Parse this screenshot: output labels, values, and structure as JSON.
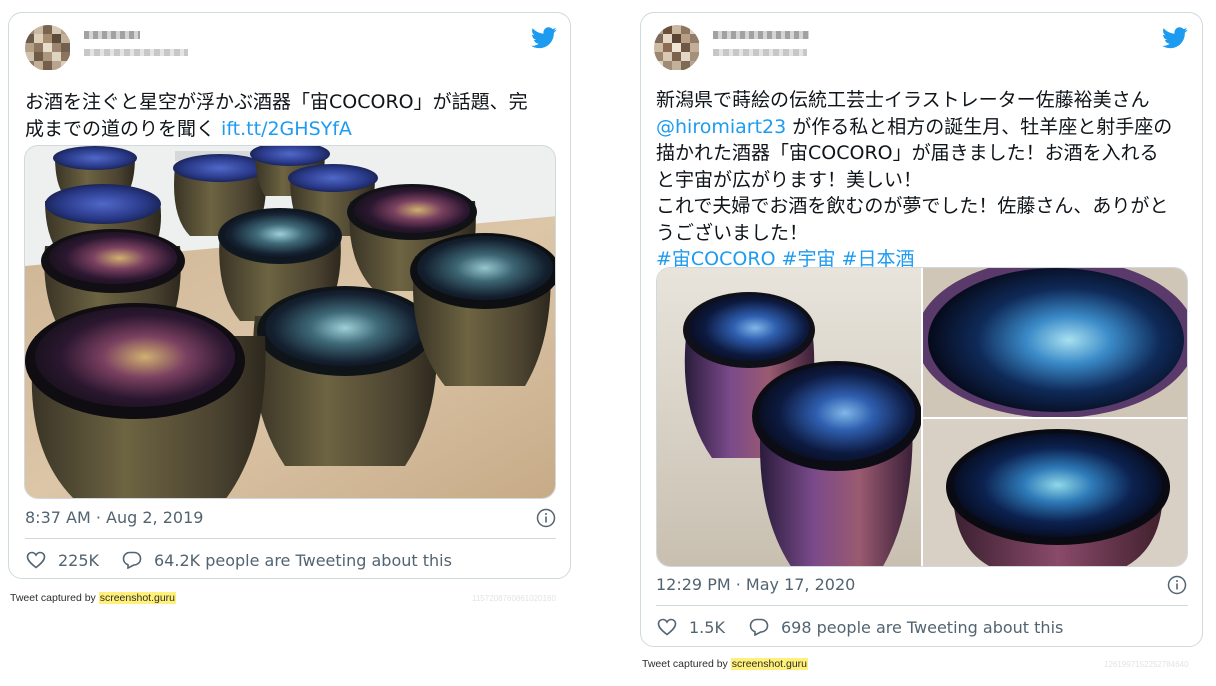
{
  "tweets": [
    {
      "text_lines": [
        "お酒を注ぐと星空が浮かぶ酒器「宙COCORO」が話題、完",
        "成までの道のりを聞く "
      ],
      "link": "ift.tt/2GHSYfA",
      "timestamp": "8:37 AM · Aug 2, 2019",
      "likes": "225K",
      "replies": "64.2K people are Tweeting about this",
      "caption_prefix": "Tweet captured by ",
      "caption_site": "screenshot.guru",
      "tweet_id": "1157208760861020160"
    },
    {
      "text_lines": [
        "新潟県で蒔絵の伝統工芸士イラストレーター佐藤裕美さん",
        " が作る私と相方の誕生月、牡羊座と射手座の",
        "描かれた酒器「宙COCORO」が届きました！お酒を入れる",
        "と宇宙が広がります！美しい！",
        "これで夫婦でお酒を飲むのが夢でした！佐藤さん、ありがと",
        "うございました！"
      ],
      "mention": "@hiromiart23",
      "hashtags": "#宙COCORO #宇宙 #日本酒",
      "timestamp": "12:29 PM · May 17, 2020",
      "likes": "1.5K",
      "replies": "698 people are Tweeting about this",
      "caption_prefix": "Tweet captured by ",
      "caption_site": "screenshot.guru",
      "tweet_id": "1261997152252784640"
    }
  ],
  "colors": {
    "link": "#1d9bf0",
    "twitter_blue": "#1d9bf0",
    "meta_gray": "#536471",
    "border": "#cfd9de"
  },
  "icons": [
    "twitter-bird-icon",
    "info-icon",
    "heart-icon",
    "speech-bubble-icon"
  ]
}
